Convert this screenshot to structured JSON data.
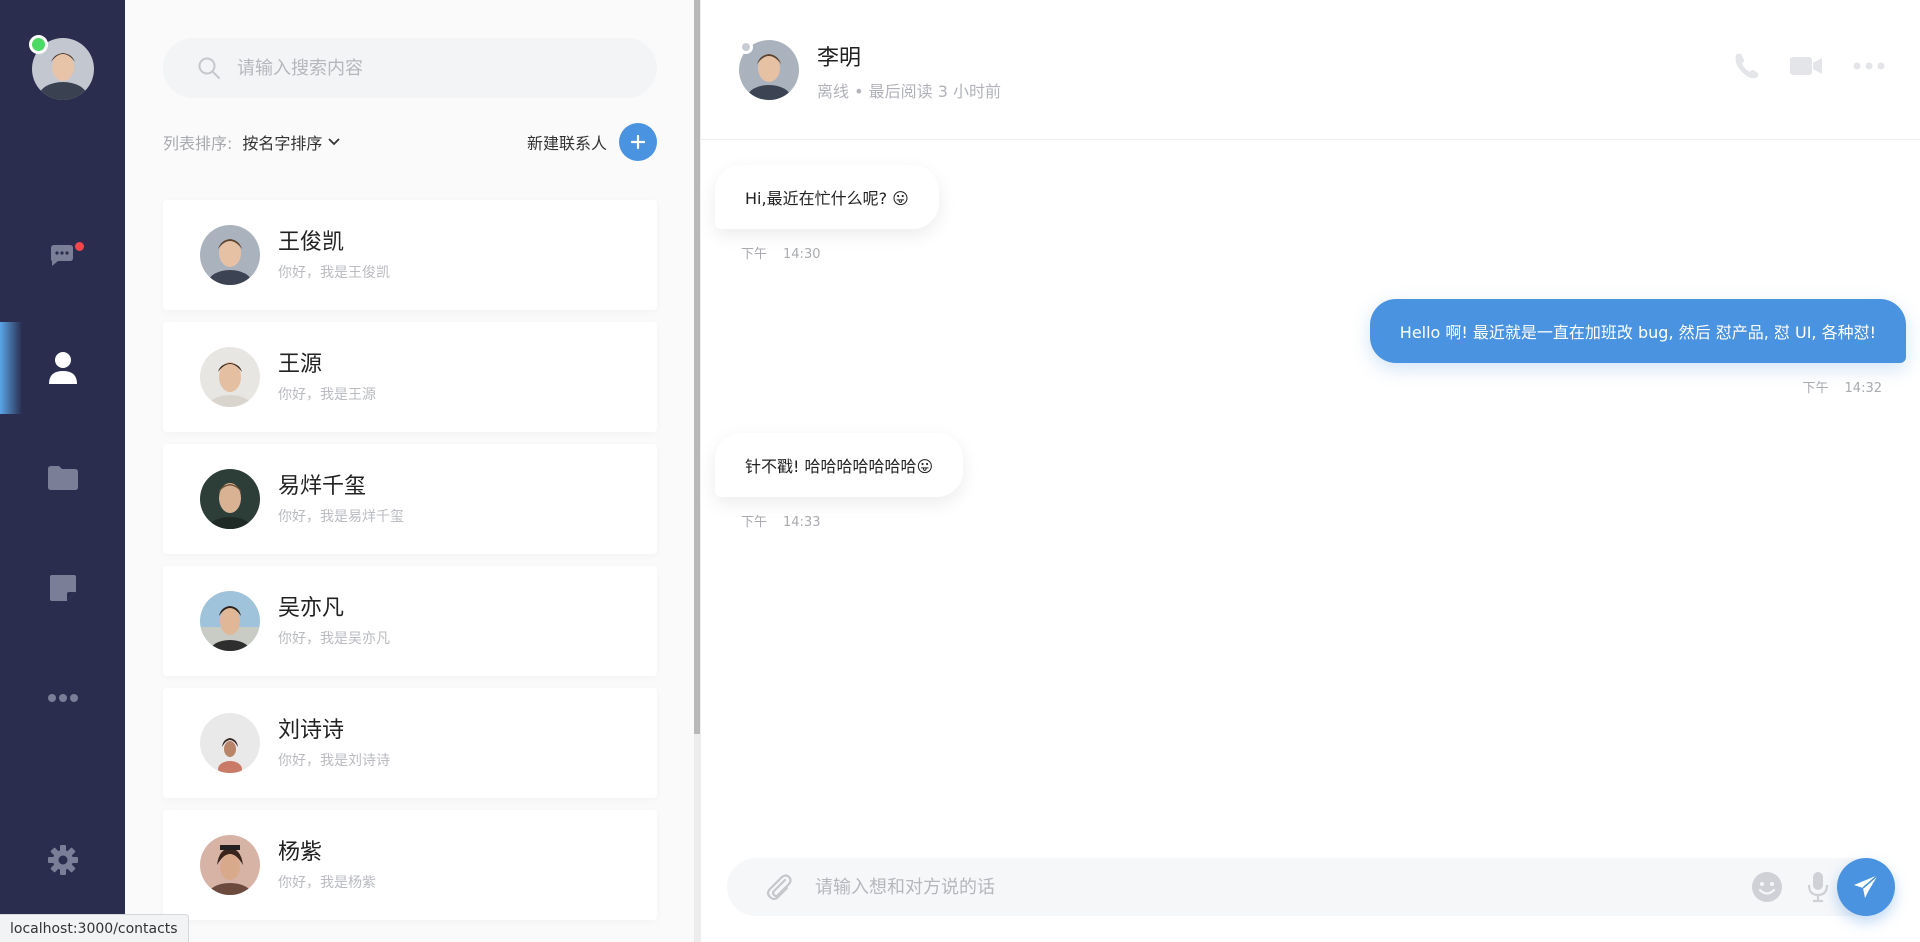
{
  "colors": {
    "rail_bg": "#2a2d4e",
    "accent": "#4a93e0",
    "online": "#4cd964",
    "badge": "#f5454b"
  },
  "rail": {
    "items": [
      {
        "icon": "chat-icon",
        "active": false,
        "badge": true
      },
      {
        "icon": "user-icon",
        "active": true,
        "badge": false
      },
      {
        "icon": "folder-icon",
        "active": false,
        "badge": false
      },
      {
        "icon": "note-icon",
        "active": false,
        "badge": false
      },
      {
        "icon": "more-icon",
        "active": false,
        "badge": false
      }
    ],
    "settings_icon": "gear-icon"
  },
  "contacts_panel": {
    "search": {
      "placeholder": "请输入搜索内容",
      "value": ""
    },
    "sort_label": "列表排序:",
    "sort_value": "按名字排序",
    "new_contact_label": "新建联系人",
    "contacts": [
      {
        "name": "王俊凯",
        "message": "你好，我是王俊凯"
      },
      {
        "name": "王源",
        "message": "你好，我是王源"
      },
      {
        "name": "易烊千玺",
        "message": "你好，我是易烊千玺"
      },
      {
        "name": "吴亦凡",
        "message": "你好，我是吴亦凡"
      },
      {
        "name": "刘诗诗",
        "message": "你好，我是刘诗诗"
      },
      {
        "name": "杨紫",
        "message": "你好，我是杨紫"
      }
    ]
  },
  "chat": {
    "header": {
      "name": "李明",
      "status": "离线 • 最后阅读 3 小时前"
    },
    "messages": [
      {
        "direction": "in",
        "text": "Hi,最近在忙什么呢? 😛",
        "period": "下午",
        "time": "14:30"
      },
      {
        "direction": "out",
        "text": "Hello 啊! 最近就是一直在加班改 bug, 然后 怼产品, 怼 UI, 各种怼!",
        "period": "下午",
        "time": "14:32"
      },
      {
        "direction": "in",
        "text": "针不戳! 哈哈哈哈哈哈哈😛",
        "period": "下午",
        "time": "14:33"
      }
    ],
    "composer": {
      "placeholder": "请输入想和对方说的话",
      "value": ""
    }
  },
  "status_url": "localhost:3000/contacts"
}
